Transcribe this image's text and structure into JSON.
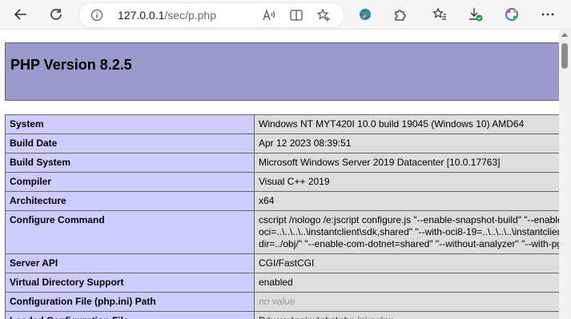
{
  "browser": {
    "url_host": "127.0.0.1",
    "url_path": "/sec/p.php"
  },
  "page": {
    "title": "PHP Version 8.2.5",
    "rows": [
      {
        "key": "System",
        "value": "Windows NT MYT420I 10.0 build 19045 (Windows 10) AMD64"
      },
      {
        "key": "Build Date",
        "value": "Apr 12 2023 08:39:51"
      },
      {
        "key": "Build System",
        "value": "Microsoft Windows Server 2019 Datacenter [10.0.17763]"
      },
      {
        "key": "Compiler",
        "value": "Visual C++ 2019"
      },
      {
        "key": "Architecture",
        "value": "x64"
      },
      {
        "key": "Configure Command",
        "value_lines": [
          "cscript /nologo /e:jscript configure.js \"--enable-snapshot-build\" \"--enable-debug-pack\" \"--with-pdo-",
          "oci=..\\..\\..\\..\\instantclient\\sdk,shared\" \"--with-oci8-19=..\\..\\..\\..\\instantclient\\sdk,shared\" \"--enable-object-out-",
          "dir=../obj/\" \"--enable-com-dotnet=shared\" \"--without-analyzer\" \"--with-pgo\""
        ]
      },
      {
        "key": "Server API",
        "value": "CGI/FastCGI"
      },
      {
        "key": "Virtual Directory Support",
        "value": "enabled"
      },
      {
        "key": "Configuration File (php.ini) Path",
        "value": "no value"
      },
      {
        "key": "Loaded Configuration File",
        "value": "D:\\www\\nginx\\php\\php.ini-nginx"
      }
    ]
  },
  "colors": {
    "header_bg": "#9999cc",
    "key_bg": "#ccccff",
    "value_bg": "#dddddd"
  }
}
